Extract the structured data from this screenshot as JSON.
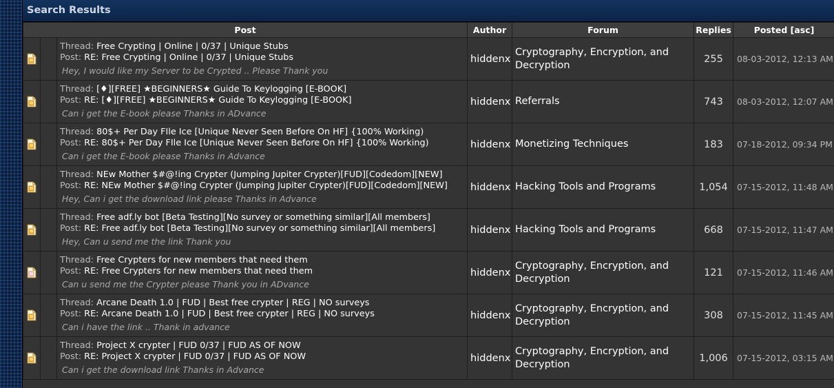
{
  "header": {
    "title": "Search Results"
  },
  "columns": {
    "post": "Post",
    "author": "Author",
    "forum": "Forum",
    "replies": "Replies",
    "posted": "Posted [asc]"
  },
  "labels": {
    "thread_prefix": "Thread:",
    "post_prefix": "Post:"
  },
  "icons": {
    "hot_folder": "hot-thread-folder-icon",
    "normal_folder": "thread-folder-icon"
  },
  "colors": {
    "panel": "#333333",
    "title_bar": "#0d2b52",
    "background": "#0a1a33"
  },
  "rows": [
    {
      "thread": "Free Crypting | Online | 0/37 | Unique Stubs",
      "post": "RE: Free Crypting | Online | 0/37 | Unique Stubs",
      "excerpt": "Hey, I would like my Server to be Crypted .. Please Thank you",
      "author": "hiddenx",
      "forum_line1": "Cryptography, Encryption, and",
      "forum_line2": "Decryption",
      "replies": "255",
      "posted": "08-03-2012, 12:13 AM",
      "icon": "hot"
    },
    {
      "thread": "[♦][FREE] ★BEGINNERS★ Guide To Keylogging [E-BOOK]",
      "post": "RE: [♦][FREE] ★BEGINNERS★ Guide To Keylogging [E-BOOK]",
      "excerpt": "Can i get the E-book please Thanks in ADvance",
      "author": "hiddenx",
      "forum_line1": "Referrals",
      "forum_line2": "",
      "replies": "743",
      "posted": "08-03-2012, 12:07 AM",
      "icon": "hot"
    },
    {
      "thread": "80$+ Per Day FIle Ice [Unique Never Seen Before On HF] {100% Working)",
      "post": "RE: 80$+ Per Day FIle Ice [Unique Never Seen Before On HF] {100% Working)",
      "excerpt": "Can i get the E-book please Thanks in Advance",
      "author": "hiddenx",
      "forum_line1": "Monetizing Techniques",
      "forum_line2": "",
      "replies": "183",
      "posted": "07-18-2012, 09:34 PM",
      "icon": "hot"
    },
    {
      "thread": "NEw Mother $#@!ing Crypter (Jumping Jupiter Crypter)[FUD][Codedom][NEW]",
      "post": "RE: NEw Mother $#@!ing Crypter (Jumping Jupiter Crypter)[FUD][Codedom][NEW]",
      "excerpt": "Hey, Can i get the download link please Thanks in Advance",
      "author": "hiddenx",
      "forum_line1": "Hacking Tools and Programs",
      "forum_line2": "",
      "replies": "1,054",
      "posted": "07-15-2012, 11:48 AM",
      "icon": "hot"
    },
    {
      "thread": "Free adf.ly bot [Beta Testing][No survey or something similar][All members]",
      "post": "RE: Free adf.ly bot [Beta Testing][No survey or something similar][All members]",
      "excerpt": "Hey, Can u send me the link Thank you",
      "author": "hiddenx",
      "forum_line1": "Hacking Tools and Programs",
      "forum_line2": "",
      "replies": "668",
      "posted": "07-15-2012, 11:47 AM",
      "icon": "hot"
    },
    {
      "thread": "Free Crypters for new members that need them",
      "post": "RE: Free Crypters for new members that need them",
      "excerpt": "Can u send me the Crypter please Thank you in ADvance",
      "author": "hiddenx",
      "forum_line1": "Cryptography, Encryption, and",
      "forum_line2": "Decryption",
      "replies": "121",
      "posted": "07-15-2012, 11:46 AM",
      "icon": "normal"
    },
    {
      "thread": "Arcane Death 1.0 | FUD | Best free crypter | REG | NO surveys",
      "post": "RE: Arcane Death 1.0 | FUD | Best free crypter | REG | NO surveys",
      "excerpt": "Can i have the link .. Thank in advance",
      "author": "hiddenx",
      "forum_line1": "Cryptography, Encryption, and",
      "forum_line2": "Decryption",
      "replies": "308",
      "posted": "07-15-2012, 11:45 AM",
      "icon": "hot"
    },
    {
      "thread": "Project X crypter | FUD 0/37 | FUD AS OF NOW",
      "post": "RE: Project X crypter | FUD 0/37 | FUD AS OF NOW",
      "excerpt": "Can i get the download link Thanks in Advance",
      "author": "hiddenx",
      "forum_line1": "Cryptography, Encryption, and",
      "forum_line2": "Decryption",
      "replies": "1,006",
      "posted": "07-15-2012, 03:15 AM",
      "icon": "hot"
    }
  ]
}
